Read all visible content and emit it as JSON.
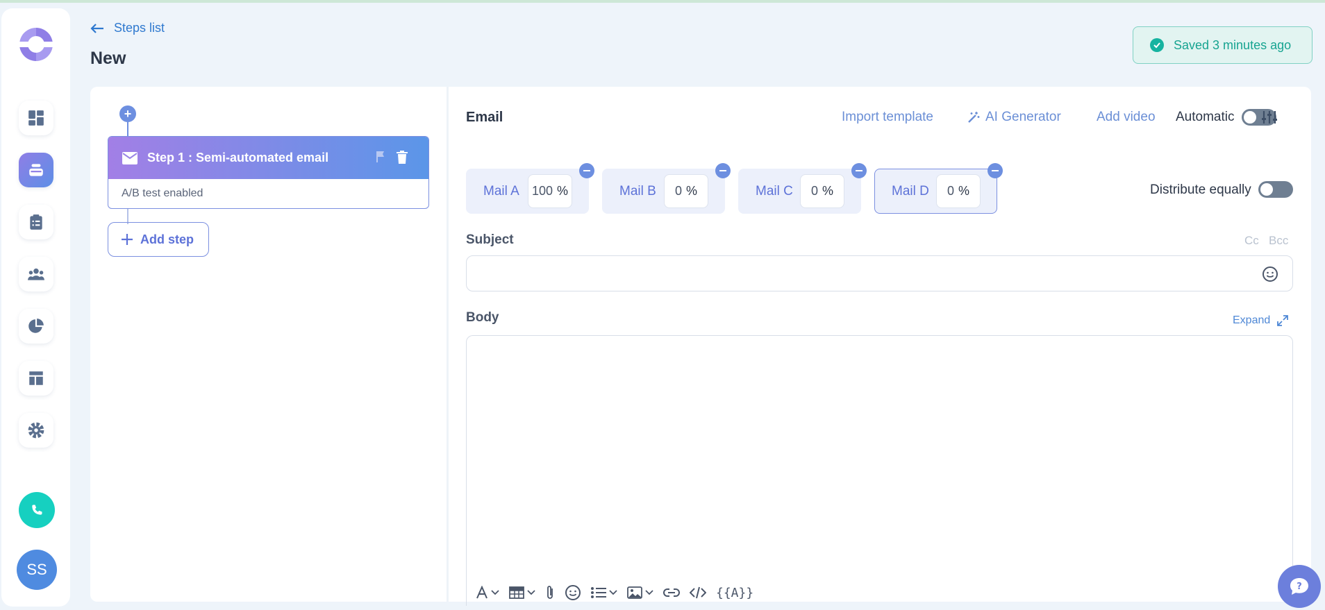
{
  "header": {
    "back_label": "Steps list",
    "page_title": "New",
    "saved_status": "Saved 3 minutes ago"
  },
  "sidebar": {
    "items": [
      {
        "icon": "dashboard-icon"
      },
      {
        "icon": "sequences-icon",
        "active": true
      },
      {
        "icon": "tasks-icon"
      },
      {
        "icon": "contacts-icon"
      },
      {
        "icon": "reports-icon"
      },
      {
        "icon": "templates-icon"
      },
      {
        "icon": "settings-icon"
      }
    ],
    "phone_icon": "phone-icon",
    "avatar_initials": "SS"
  },
  "steps": {
    "step1_title": "Step 1 : Semi-automated email",
    "step1_subtitle": "A/B test enabled",
    "add_step_label": "Add step"
  },
  "email": {
    "title": "Email",
    "import_template": "Import template",
    "ai_generator": "AI Generator",
    "add_video": "Add video",
    "automatic_label": "Automatic",
    "automatic_on": false,
    "mails": [
      {
        "label": "Mail A",
        "value": "100",
        "unit": "%"
      },
      {
        "label": "Mail B",
        "value": "0",
        "unit": "%"
      },
      {
        "label": "Mail C",
        "value": "0",
        "unit": "%"
      },
      {
        "label": "Mail D",
        "value": "0",
        "unit": "%",
        "selected": true
      }
    ],
    "distribute_label": "Distribute equally",
    "distribute_on": false,
    "subject_label": "Subject",
    "subject_value": "",
    "cc_label": "Cc",
    "bcc_label": "Bcc",
    "body_label": "Body",
    "expand_label": "Expand",
    "variable_tool": "{{A}}"
  },
  "colors": {
    "accent": "#6d8fe0",
    "success": "#16b3a0",
    "phone": "#16d0c0"
  }
}
